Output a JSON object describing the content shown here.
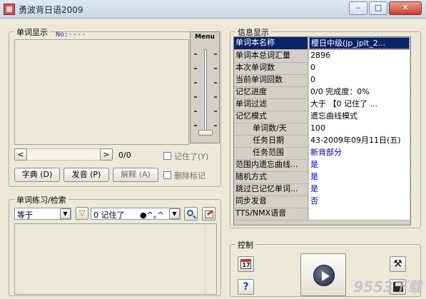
{
  "window": {
    "title": "勇波背日语2009",
    "min": "–",
    "max": "□",
    "close": "✕"
  },
  "left": {
    "word_display_title": "单词显示",
    "no_label": "No:----",
    "menu_label": "Menu",
    "counter": "0/0",
    "remembered_label": "记住了",
    "remembered_key": "(Y)",
    "dict_button": "字典",
    "dict_key": "(D)",
    "pronounce_button": "发音",
    "pronounce_key": "(P)",
    "explain_button": "解释",
    "explain_key": "(A)",
    "delete_mark_label": "删除标记",
    "practice_title": "单词练习/检索",
    "practice_select": "等于",
    "practice_filter_value": "0 记住了",
    "practice_symbols": "●^｡^"
  },
  "info": {
    "title": "信息显示",
    "rows": [
      {
        "k": "单词本名称",
        "v": "樱日中级(jp_jplt_2..."
      },
      {
        "k": "单词本总词汇量",
        "v": "2896"
      },
      {
        "k": "本次单词数",
        "v": "0"
      },
      {
        "k": "当前单词回数",
        "v": "0"
      },
      {
        "k": "记忆进度",
        "v": "0/0          完成度：0%"
      },
      {
        "k": "单词过滤",
        "v": "大于  【0 记住了    ..."
      },
      {
        "k": "记忆模式",
        "v": "遗忘曲线模式"
      },
      {
        "k": "单词数/天",
        "v": "100"
      },
      {
        "k": "任务日期",
        "v": "43-2009年09月11日(五)"
      },
      {
        "k": "任务范围",
        "v": "新背部分"
      },
      {
        "k": "范围内遗忘曲线...",
        "v": "是"
      },
      {
        "k": "随机方式",
        "v": "是"
      },
      {
        "k": "跳过已记忆单词...",
        "v": "是"
      },
      {
        "k": "同步发音",
        "v": "否"
      },
      {
        "k": "TTS/NMX语音",
        "v": ""
      }
    ]
  },
  "control": {
    "title": "控制",
    "calendar_day": "17",
    "help_symbol": "?",
    "tools_symbol": "⚒",
    "play_symbol": "▶"
  },
  "watermark": "9553下载"
}
